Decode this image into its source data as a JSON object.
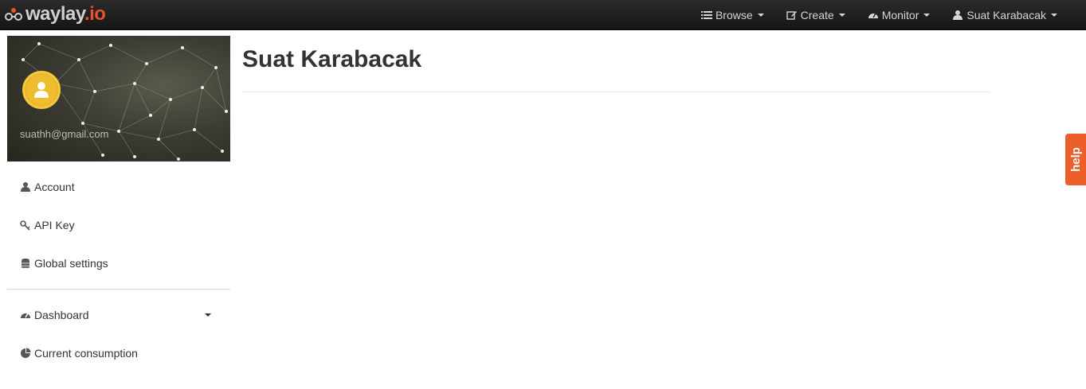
{
  "brand": {
    "name": "waylay",
    "suffix": ".io"
  },
  "nav": [
    {
      "label": "Browse",
      "icon": "list-icon"
    },
    {
      "label": "Create",
      "icon": "edit-icon"
    },
    {
      "label": "Monitor",
      "icon": "dashboard-icon"
    },
    {
      "label": "Suat Karabacak",
      "icon": "user-icon"
    }
  ],
  "profile": {
    "email": "suathh@gmail.com"
  },
  "sidebar": {
    "items": [
      {
        "label": "Account",
        "icon": "user-icon"
      },
      {
        "label": "API Key",
        "icon": "key-icon"
      },
      {
        "label": "Global settings",
        "icon": "database-icon"
      }
    ],
    "items2": [
      {
        "label": "Dashboard",
        "icon": "dashboard-icon"
      },
      {
        "label": "Current consumption",
        "icon": "pie-chart-icon"
      }
    ]
  },
  "main": {
    "title": "Suat Karabacak"
  },
  "help": {
    "label": "help"
  },
  "colors": {
    "accent": "#e8522f",
    "help": "#ec5f2b",
    "avatar": "#f0bd2f",
    "navbar": "#1e1e1e"
  }
}
